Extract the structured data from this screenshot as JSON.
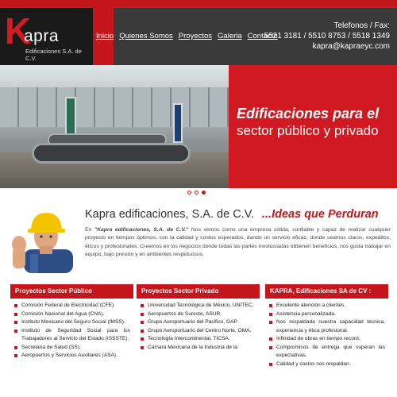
{
  "header": {
    "logo_letter": "K",
    "logo_word": "apra",
    "logo_subtitle": "Edificaciones S.A. de C.V.",
    "nav": [
      "Inicio",
      "Quienes Somos",
      "Proyectos",
      "Galeria",
      "Contacto"
    ],
    "contact_label": "Telefonos / Fax:",
    "phones": "5521 3181 / 5510 8753 / 5518 1349",
    "email": "kapra@kapraeyc.com"
  },
  "banner": {
    "line1": "Edificaciones para el",
    "line2": "sector público y privado",
    "slides": 3,
    "active_slide": 3
  },
  "intro": {
    "title": "Kapra edificaciones, S.A. de C.V.",
    "slogan": "...Ideas que Perduran",
    "body_prefix": "En ",
    "body_company": "\"Kapra edificaciones, S.A. de C.V.\"",
    "body": " Nos vemos como una empresa sólida, confiable y capaz de realizar cualquier proyecto en tiempos óptimos, con la calidad y costos esperados, dando un servicio eficaz, donde seamos claros, expeditos, éticos y profesionales. Creemos en los negocios donde todas las partes involucradas obtienen beneficios, nos gusta trabajar en equipo, bajo presión y en ambientes respetuosos."
  },
  "columns": [
    {
      "title": "Proyectos Sector Público",
      "items": [
        "Comisión Federal de Electricidad (CFE).",
        "Comisión Nacional del Agua (CNA).",
        "Instituto Mexicano del Seguro Social (IMSS).",
        "Instituto de Seguridad Social para los Trabajadores al Servicio del Estado (ISSSTE).",
        "Secretaria de Salud (SS).",
        "Aeropuertos y Servicios Auxiliares (ASA)."
      ]
    },
    {
      "title": "Proyectos Sector Privado",
      "items": [
        "Universidad Tecnológica de México, UNITEC.",
        "Aeropuertos de Sureste, ASUR.",
        "Grupo Aeroportuario del Pacifico, GAP.",
        "Grupo Aeroportuario del Centro Norte, OMA.",
        "Tecnología Intercontinental, TICSA.",
        "Cámara Mexicana de la Industria de la"
      ]
    },
    {
      "title": "KAPRA, Edificaciones SA de CV :",
      "items": [
        "Excelente atención a clientes.",
        "Asistencia personalizada.",
        "Nos respaldada nuestra capacidad técnica, experiencia y ética profesional.",
        "Infinidad de obras en tiempo record.",
        "Compromisos de entrega que superan las expectativas.",
        "Calidad y costos nos respaldan."
      ]
    }
  ],
  "colors": {
    "brand_red": "#c4161c",
    "header_dark": "#3a3a3a",
    "logo_dark": "#1a1a1a"
  }
}
